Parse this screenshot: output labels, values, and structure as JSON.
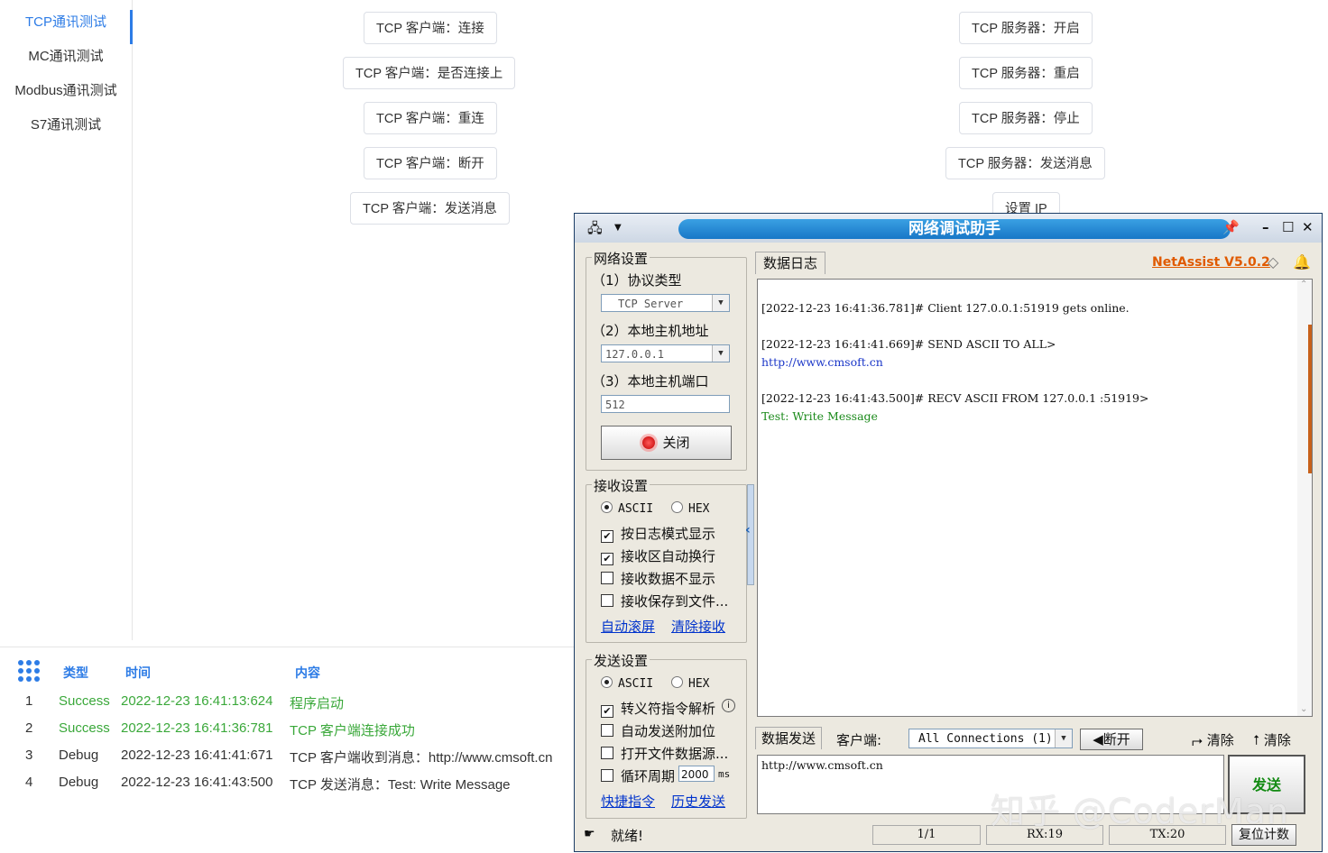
{
  "nav": {
    "items": [
      {
        "label": "TCP通讯测试",
        "active": true
      },
      {
        "label": "MC通讯测试"
      },
      {
        "label": "Modbus通讯测试"
      },
      {
        "label": "S7通讯测试"
      }
    ]
  },
  "client_buttons": [
    "TCP 客户端：连接",
    "TCP 客户端：是否连接上",
    "TCP 客户端：重连",
    "TCP 客户端：断开",
    "TCP 客户端：发送消息"
  ],
  "server_buttons": [
    "TCP 服务器：开启",
    "TCP 服务器：重启",
    "TCP 服务器：停止",
    "TCP 服务器：发送消息",
    "设置 IP"
  ],
  "log": {
    "headers": {
      "type": "类型",
      "time": "时间",
      "content": "内容"
    },
    "rows": [
      {
        "idx": "1",
        "type": "Success",
        "time": "2022-12-23 16:41:13:624",
        "msg": "程序启动"
      },
      {
        "idx": "2",
        "type": "Success",
        "time": "2022-12-23 16:41:36:781",
        "msg": "TCP 客户端连接成功"
      },
      {
        "idx": "3",
        "type": "Debug",
        "time": "2022-12-23 16:41:41:671",
        "msg": "TCP 客户端收到消息：http://www.cmsoft.cn"
      },
      {
        "idx": "4",
        "type": "Debug",
        "time": "2022-12-23 16:41:43:500",
        "msg": "TCP 发送消息：Test: Write Message"
      }
    ]
  },
  "netassist": {
    "title": "网络调试助手",
    "version": "NetAssist V5.0.2",
    "network": {
      "group_title": "网络设置",
      "protocol_label": "（1）协议类型",
      "protocol_value": "TCP Server",
      "host_label": "（2）本地主机地址",
      "host_value": "127.0.0.1",
      "port_label": "（3）本地主机端口",
      "port_value": "512",
      "close_button": "关闭"
    },
    "receive": {
      "group_title": "接收设置",
      "ascii": "ASCII",
      "hex": "HEX",
      "options": [
        {
          "label": "按日志模式显示",
          "checked": true
        },
        {
          "label": "接收区自动换行",
          "checked": true
        },
        {
          "label": "接收数据不显示",
          "checked": false
        },
        {
          "label": "接收保存到文件...",
          "checked": false
        }
      ],
      "auto_scroll": "自动滚屏",
      "clear_recv": "清除接收"
    },
    "send": {
      "group_title": "发送设置",
      "ascii": "ASCII",
      "hex": "HEX",
      "options": [
        {
          "label": "转义符指令解析",
          "checked": true
        },
        {
          "label": "自动发送附加位",
          "checked": false
        },
        {
          "label": "打开文件数据源...",
          "checked": false
        }
      ],
      "cycle_label": "循环周期",
      "cycle_value": "2000",
      "cycle_unit": "ms",
      "quick_cmd": "快捷指令",
      "history": "历史发送"
    },
    "data_log_tab": "数据日志",
    "log_lines": [
      {
        "text": "[2022-12-23 16:41:36.781]# Client 127.0.0.1:51919 gets online.",
        "color": "#333333"
      },
      {
        "text": "[2022-12-23 16:41:41.669]# SEND ASCII TO ALL>",
        "color": "#333333"
      },
      {
        "text": "http://www.cmsoft.cn",
        "color": "#1a36c8"
      },
      {
        "text": "[2022-12-23 16:41:43.500]# RECV ASCII FROM 127.0.0.1 :51919>",
        "color": "#333333"
      },
      {
        "text": "Test: Write Message",
        "color": "#1b8a1b"
      }
    ],
    "send_bar": {
      "tab": "数据发送",
      "client_label": "客户端:",
      "connections": "All Connections (1)",
      "disconnect": "断开",
      "clear1": "清除",
      "clear2": "清除"
    },
    "send_text": "http://www.cmsoft.cn",
    "send_button": "发送",
    "status": {
      "ready": "就绪!",
      "page": "1/1",
      "rx": "RX:19",
      "tx": "TX:20",
      "reset": "复位计数"
    }
  },
  "watermark": "知乎 @CoderMan",
  "colors": {
    "accent": "#2d7ce6",
    "success": "#3aa83a",
    "title_blue": "#1877c7",
    "version_orange": "#e05a00"
  }
}
